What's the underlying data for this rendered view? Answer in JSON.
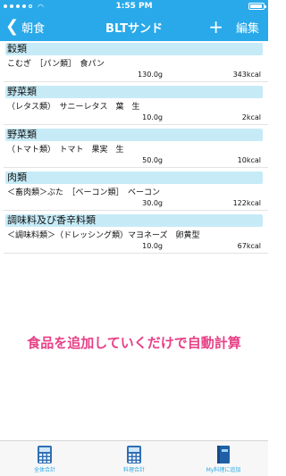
{
  "status": {
    "carrier": "●●●●○ ",
    "time": "1:55 PM",
    "battery_level": 0.8
  },
  "nav": {
    "back_label": "朝食",
    "title": "BLTサンド",
    "plus_label": "+",
    "edit_label": "編集"
  },
  "sections": [
    {
      "heading": "穀類",
      "name": "こむぎ　［パン類］　食パン",
      "amount": "130.0g",
      "kcal": "343kcal"
    },
    {
      "heading": "野菜類",
      "name": "（レタス類）　サニーレタス　葉　生",
      "amount": "10.0g",
      "kcal": "2kcal"
    },
    {
      "heading": "野菜類",
      "name": "（トマト類）　トマト　果実　生",
      "amount": "50.0g",
      "kcal": "10kcal"
    },
    {
      "heading": "肉類",
      "name": "＜畜肉類＞ぶた　［ベーコン類］　ベーコン",
      "amount": "30.0g",
      "kcal": "122kcal"
    },
    {
      "heading": "調味料及び香辛料類",
      "name": "＜調味料類＞（ドレッシング類）マヨネーズ　卵黄型",
      "amount": "10.0g",
      "kcal": "67kcal"
    }
  ],
  "promo": "食品を追加していくだけで自動計算",
  "tabs": [
    {
      "label": "全体合計",
      "icon": "calculator-icon"
    },
    {
      "label": "料理合計",
      "icon": "calculator-icon"
    },
    {
      "label": "My料理に追加",
      "icon": "book-icon"
    }
  ],
  "colors": {
    "accent": "#29a9e9",
    "section_bg": "#c6ebf7",
    "promo": "#e84087"
  }
}
